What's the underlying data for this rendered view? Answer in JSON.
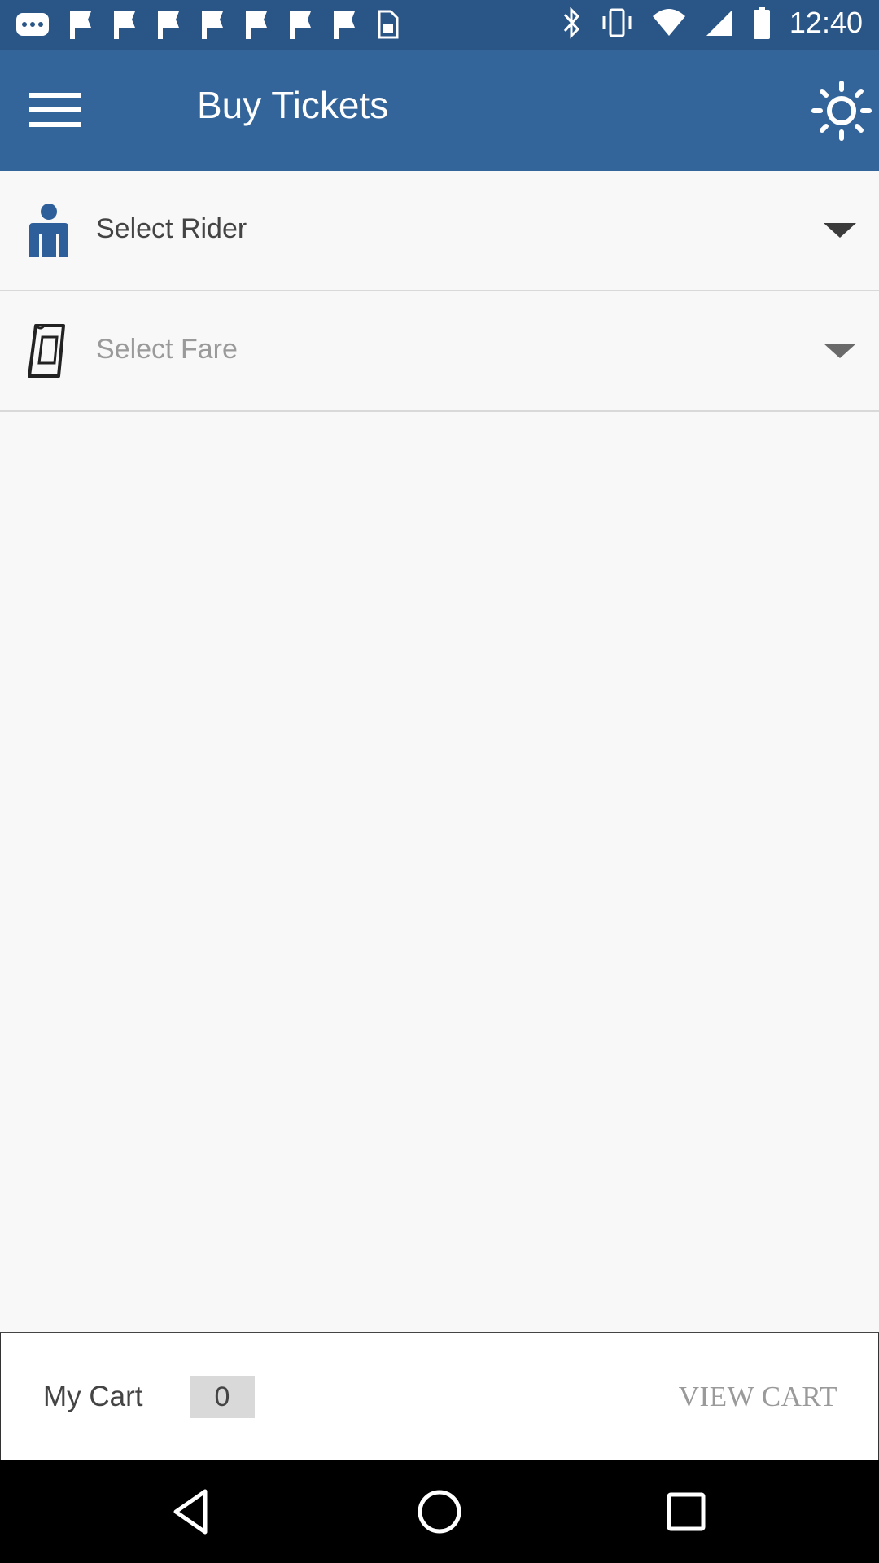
{
  "status_bar": {
    "time": "12:40",
    "icons": [
      "more-notifications-icon",
      "flag-icon",
      "flag-icon",
      "flag-icon",
      "flag-icon",
      "flag-icon",
      "flag-icon",
      "flag-icon",
      "sim-card-icon",
      "bluetooth-icon",
      "vibrate-icon",
      "wifi-icon",
      "signal-icon",
      "battery-icon"
    ]
  },
  "app_bar": {
    "title": "Buy Tickets",
    "menu_icon": "hamburger-menu-icon",
    "action_icon": "brightness-icon",
    "background": "#34659a"
  },
  "form": {
    "rider": {
      "label": "Select Rider",
      "icon": "rider-person-icon"
    },
    "fare": {
      "label": "Select Fare",
      "icon": "ticket-icon"
    }
  },
  "cart": {
    "label": "My Cart",
    "count": "0",
    "view_label": "VIEW CART"
  },
  "nav_bar": {
    "buttons": [
      "back-icon",
      "home-icon",
      "recents-icon"
    ]
  },
  "colors": {
    "primary": "#34659a",
    "status_bar": "#2a5587",
    "rider_icon": "#2f5f9a"
  }
}
